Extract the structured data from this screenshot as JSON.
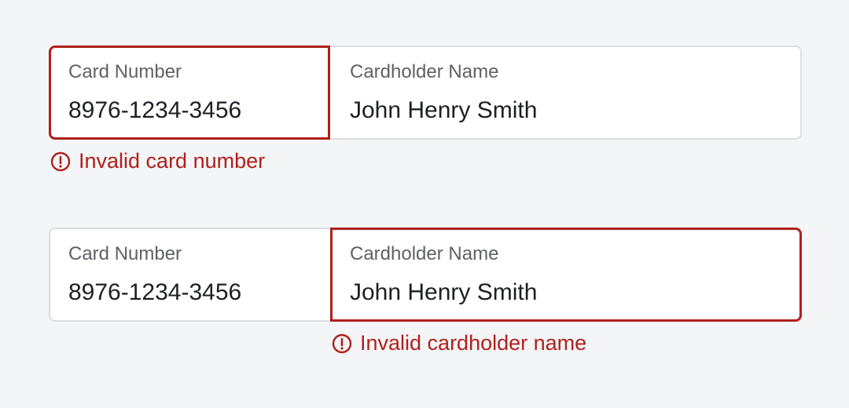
{
  "forms": [
    {
      "card_number": {
        "label": "Card Number",
        "value": "8976-1234-3456",
        "invalid": true
      },
      "cardholder_name": {
        "label": "Cardholder Name",
        "value": "John Henry Smith",
        "invalid": false
      },
      "error_message": "Invalid card number"
    },
    {
      "card_number": {
        "label": "Card Number",
        "value": "8976-1234-3456",
        "invalid": false
      },
      "cardholder_name": {
        "label": "Cardholder Name",
        "value": "John Henry Smith",
        "invalid": true
      },
      "error_message": "Invalid cardholder name"
    }
  ],
  "colors": {
    "error": "#b0201b",
    "border": "#dcdee2",
    "background": "#f4f5f7",
    "label": "#5f6166",
    "value": "#1d1f24"
  },
  "icons": {
    "error": "exclamation-circle-icon"
  }
}
